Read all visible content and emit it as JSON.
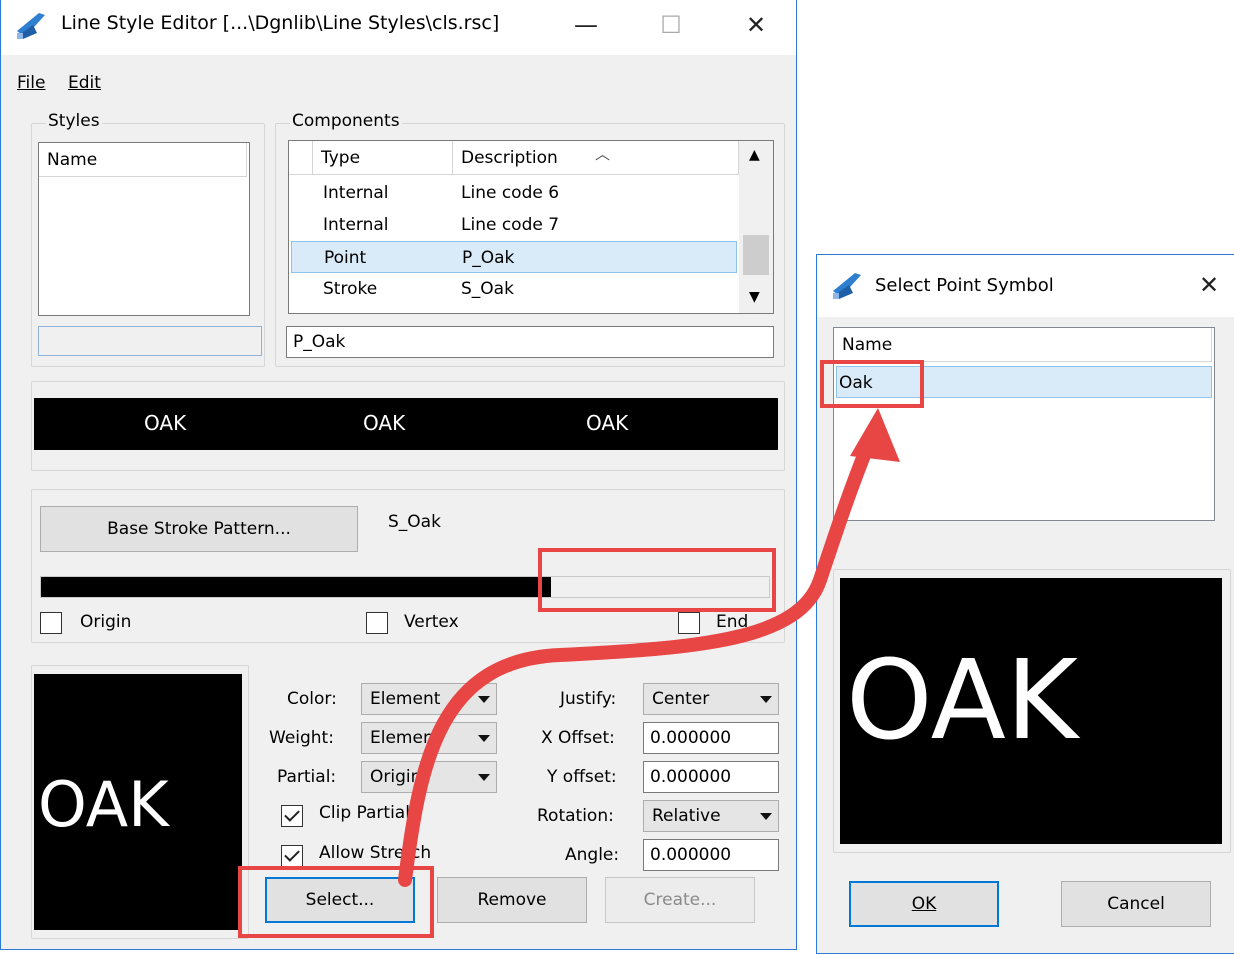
{
  "main_window": {
    "title": "Line Style Editor [...\\Dgnlib\\Line Styles\\cls.rsc]",
    "caption_minimize": "—",
    "caption_maximize": "☐",
    "caption_close": "✕",
    "menu": [
      {
        "label": "File"
      },
      {
        "label": "Edit"
      }
    ],
    "styles": {
      "group_label": "Styles",
      "column_name": "Name",
      "name_value": ""
    },
    "components": {
      "group_label": "Components",
      "col_type": "Type",
      "col_description": "Description",
      "rows": [
        {
          "type": "Internal",
          "description": "Line code 6"
        },
        {
          "type": "Internal",
          "description": "Line code 7"
        },
        {
          "type": "Point",
          "description": "P_Oak"
        },
        {
          "type": "Stroke",
          "description": "S_Oak"
        }
      ],
      "selected_value": "P_Oak"
    },
    "preview_words": [
      "OAK",
      "OAK",
      "OAK"
    ],
    "stroke": {
      "base_button": "Base Stroke Pattern...",
      "base_name": "S_Oak",
      "pattern_fill_fraction": 0.7,
      "origin_label": "Origin",
      "vertex_label": "Vertex",
      "end_label": "End"
    },
    "symbol": {
      "preview_text": "OAK",
      "color_label": "Color:",
      "color_value": "Element",
      "weight_label": "Weight:",
      "weight_value": "Element",
      "partial_label": "Partial:",
      "partial_value": "Origin",
      "clip_partial_label": "Clip Partial",
      "allow_stretch_label": "Allow Stretch",
      "justify_label": "Justify:",
      "justify_value": "Center",
      "xoffset_label": "X Offset:",
      "xoffset_value": "0.000000",
      "yoffset_label": "Y offset:",
      "yoffset_value": "0.000000",
      "rotation_label": "Rotation:",
      "rotation_value": "Relative",
      "angle_label": "Angle:",
      "angle_value": "0.000000",
      "select_button": "Select...",
      "remove_button": "Remove",
      "create_button": "Create..."
    }
  },
  "dialog": {
    "title": "Select Point Symbol",
    "close": "✕",
    "column_name": "Name",
    "items": [
      "Oak"
    ],
    "preview_text": "OAK",
    "ok_button": "OK",
    "cancel_button": "Cancel"
  },
  "colors": {
    "accent": "#0078d7",
    "selection": "#d9ebf9",
    "annotation": "#e84545"
  }
}
